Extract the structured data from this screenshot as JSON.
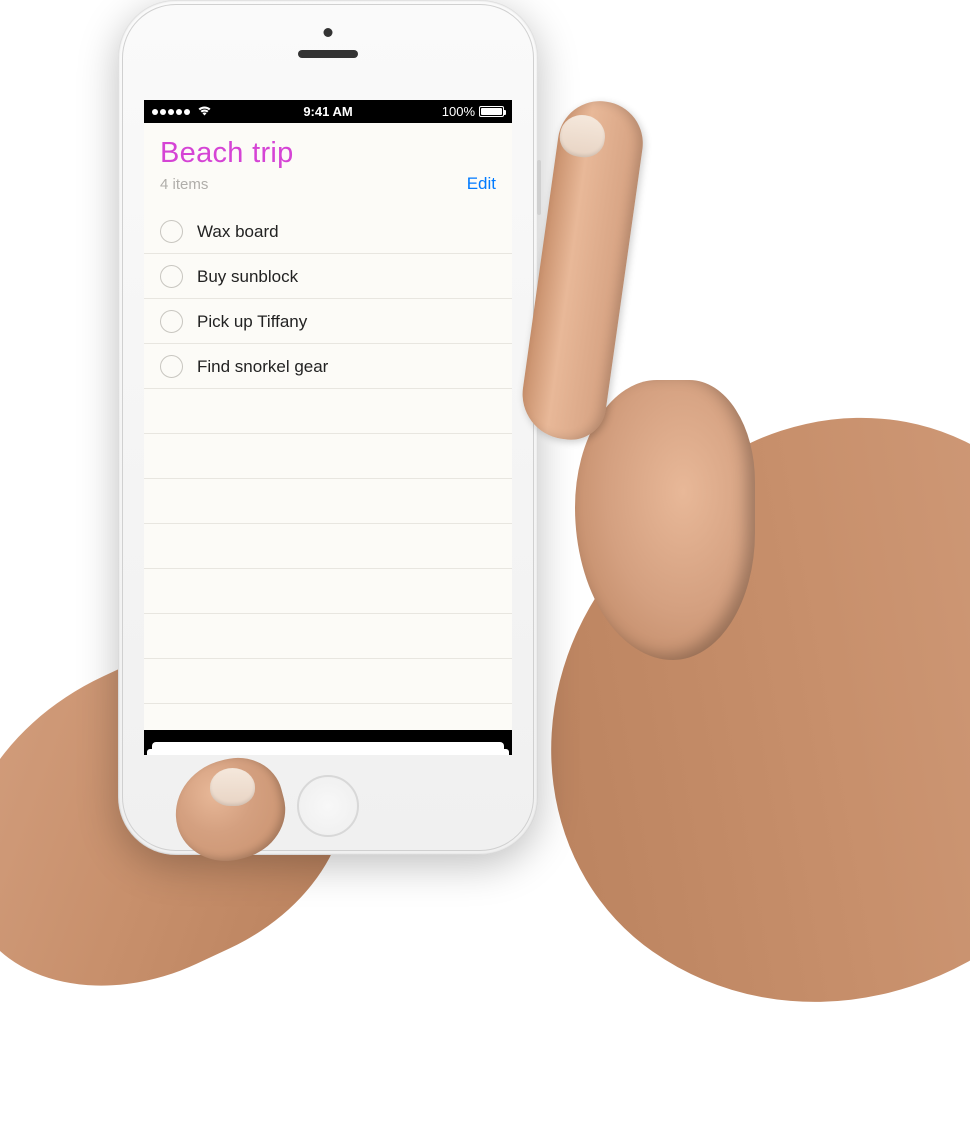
{
  "status_bar": {
    "time": "9:41 AM",
    "battery_percent": "100%"
  },
  "list": {
    "title": "Beach trip",
    "item_count": "4 items",
    "edit_label": "Edit",
    "items": [
      {
        "label": "Wax board"
      },
      {
        "label": "Buy sunblock"
      },
      {
        "label": "Pick up Tiffany"
      },
      {
        "label": "Find snorkel gear"
      }
    ]
  },
  "colors": {
    "title_color": "#d544d5",
    "accent_blue": "#007aff"
  }
}
